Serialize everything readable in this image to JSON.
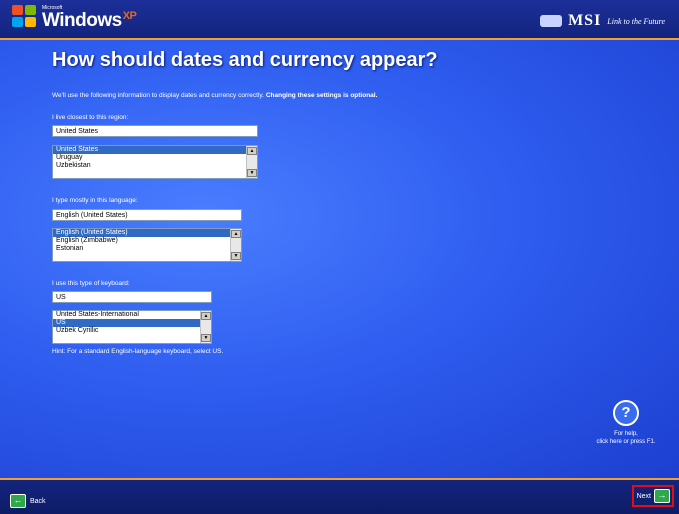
{
  "header": {
    "brand_small": "Microsoft",
    "brand": "Windows",
    "brand_xp": "XP",
    "oem": "MSI",
    "oem_tagline": "Link to the Future"
  },
  "page": {
    "title": "How should dates and currency appear?",
    "intro": "We'll use the following information to display dates and currency correctly.",
    "intro_bold": "Changing these settings is optional."
  },
  "region": {
    "label": "I live closest to this region:",
    "value": "United States",
    "options": [
      "United States",
      "Uruguay",
      "Uzbekistan"
    ],
    "selected_index": 0
  },
  "language": {
    "label": "I type mostly in this language:",
    "value": "English (United States)",
    "options": [
      "English (United States)",
      "English (Zimbabwe)",
      "Estonian"
    ],
    "selected_index": 0
  },
  "keyboard": {
    "label": "I use this type of keyboard:",
    "value": "US",
    "options": [
      "United States-International",
      "US",
      "Uzbek Cyrillic"
    ],
    "selected_index": 1
  },
  "hint": "Hint: For a standard English-language keyboard, select US.",
  "help": {
    "icon": "?",
    "line1": "For help,",
    "line2": "click here or press F1."
  },
  "footer": {
    "back_label": "Back",
    "next_label": "Next"
  },
  "colors": {
    "background": "#2f5ef0",
    "bar": "#13247e",
    "accent_line": "#f0a030",
    "selection": "#316ac5",
    "nav_button": "#2ea84a",
    "highlight_box": "#e01010"
  }
}
